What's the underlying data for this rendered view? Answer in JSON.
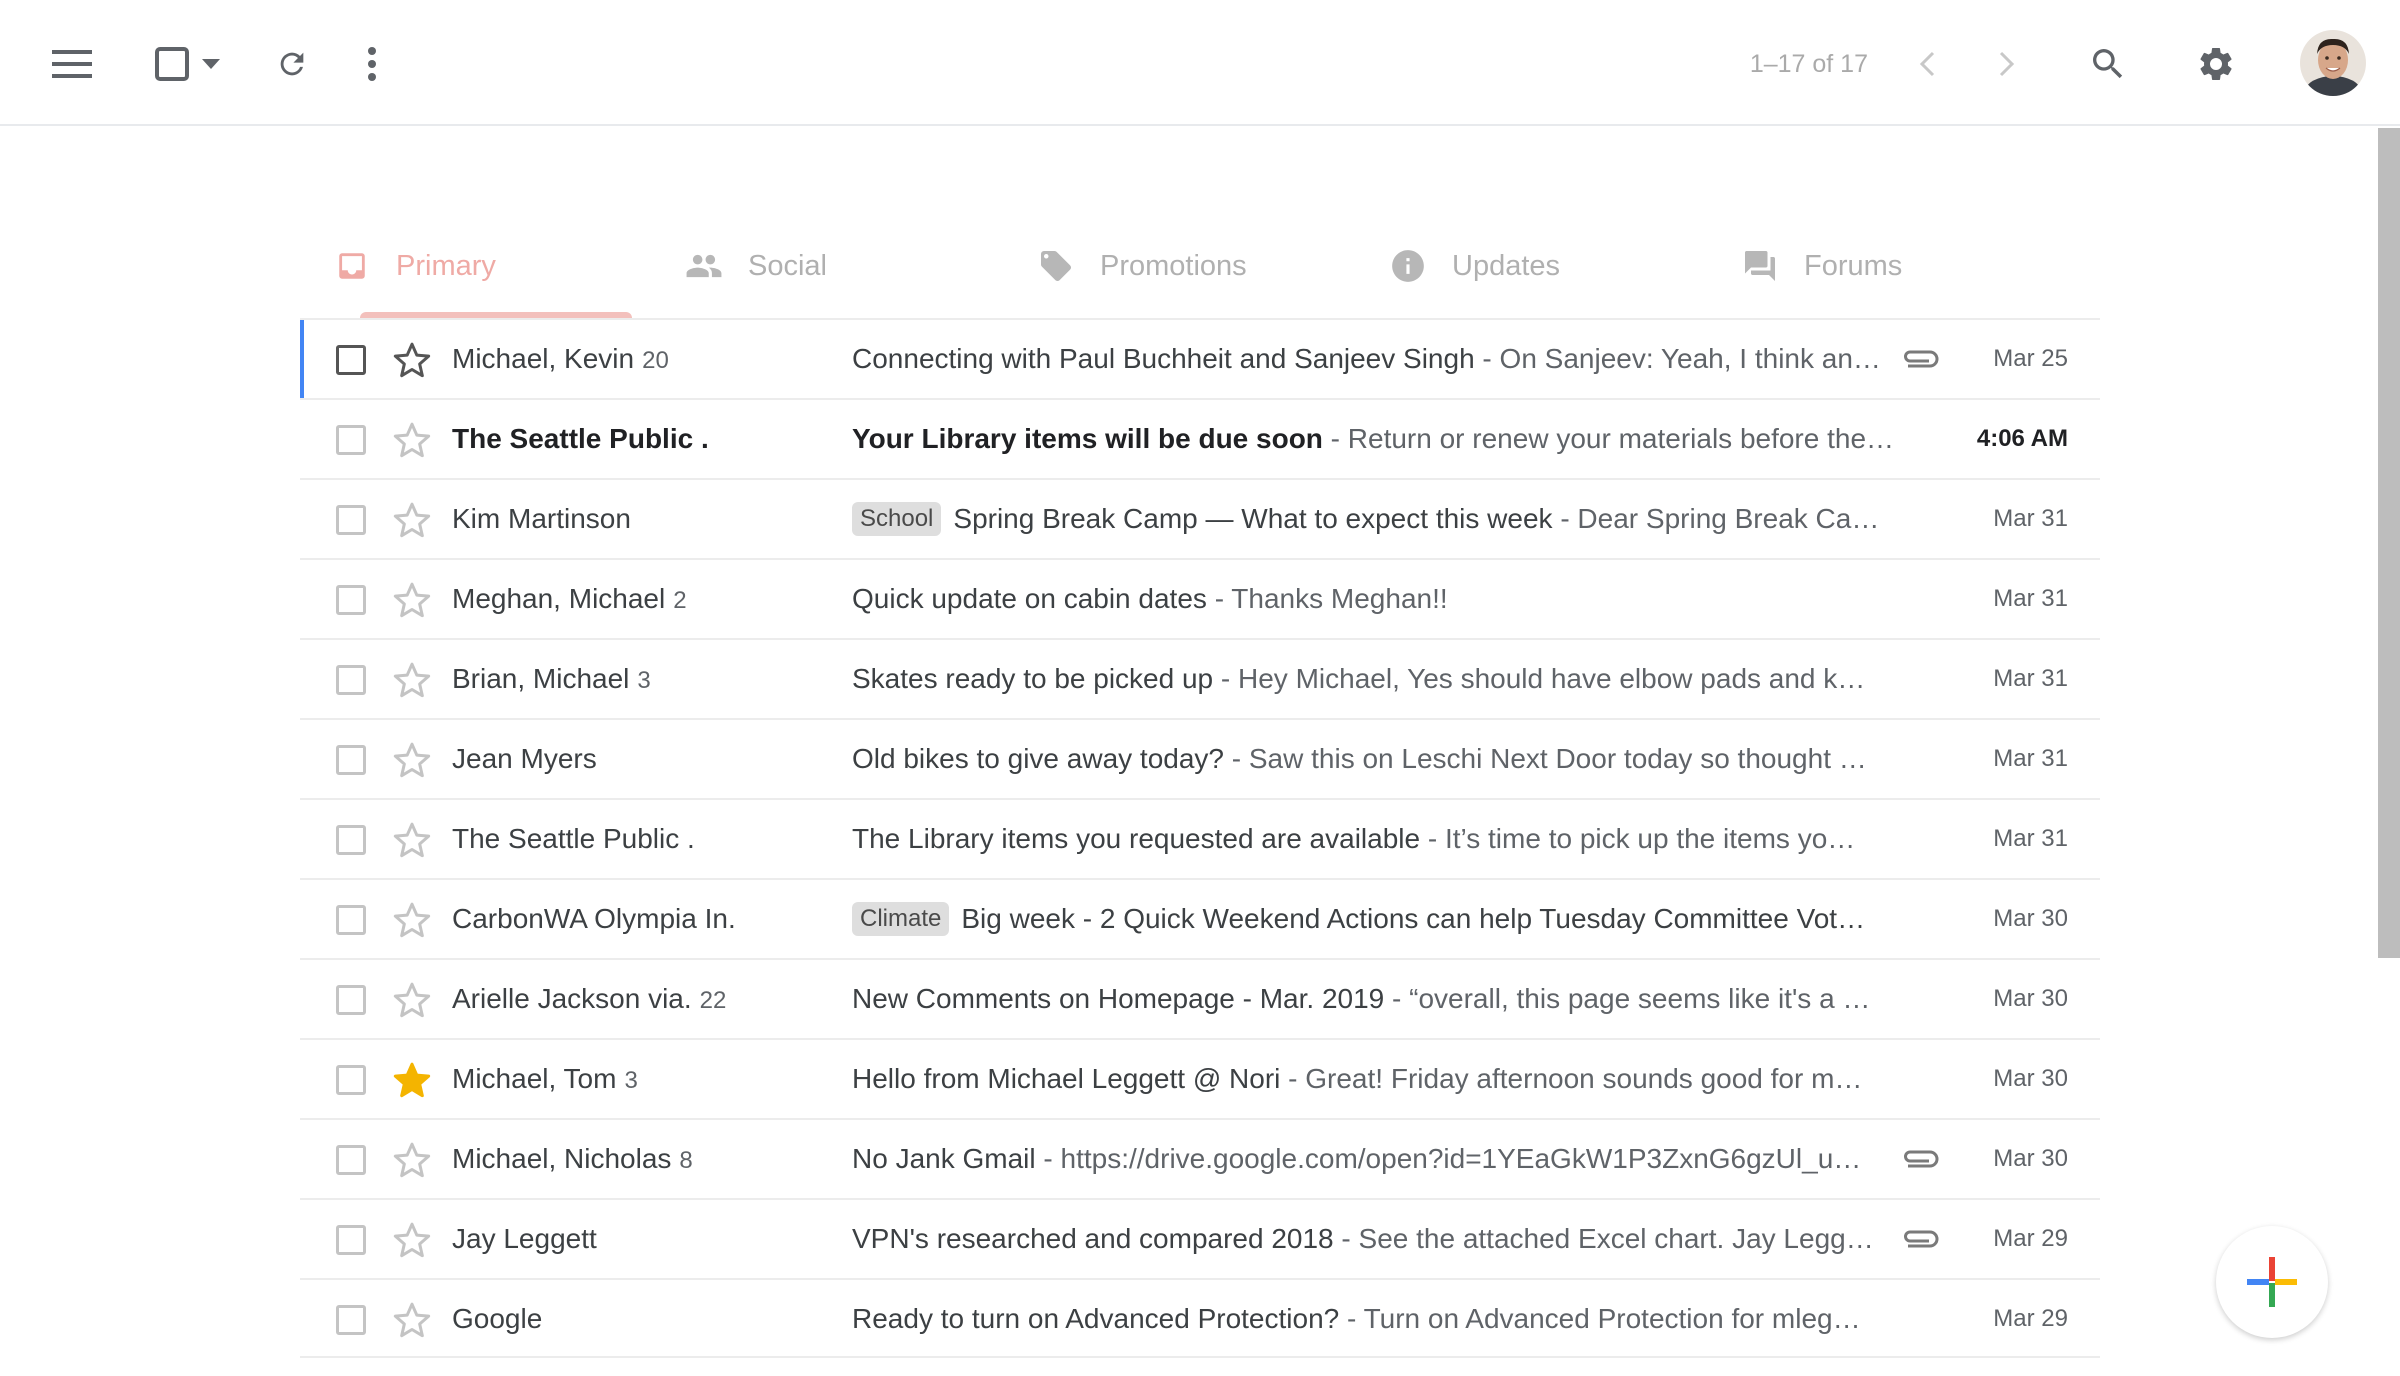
{
  "toolbar": {
    "menu_icon": "hamburger-menu-icon",
    "select_icon": "checkbox-icon",
    "select_dropdown_icon": "caret-down-icon",
    "refresh_icon": "refresh-icon",
    "more_icon": "more-vertical-icon",
    "pager_text": "1–17 of 17",
    "prev_icon": "chevron-left-icon",
    "next_icon": "chevron-right-icon",
    "search_icon": "search-icon",
    "settings_icon": "gear-icon"
  },
  "tabs": [
    {
      "label": "Primary",
      "icon": "inbox-icon",
      "active": true
    },
    {
      "label": "Social",
      "icon": "people-icon",
      "active": false
    },
    {
      "label": "Promotions",
      "icon": "tag-icon",
      "active": false
    },
    {
      "label": "Updates",
      "icon": "info-icon",
      "active": false
    },
    {
      "label": "Forums",
      "icon": "forum-icon",
      "active": false
    }
  ],
  "emails": [
    {
      "sender": "Michael, Kevin",
      "count": "20",
      "label": "",
      "subject": "Connecting with Paul Buchheit and Sanjeev Singh",
      "snippet": " - On Sanjeev: Yeah, I think an…",
      "attachment": true,
      "date": "Mar 25",
      "unread": false,
      "starred": false,
      "focused": true
    },
    {
      "sender": "The Seattle Public .",
      "count": "",
      "label": "",
      "subject": "Your Library items will be due soon",
      "snippet": " - Return or renew your materials before the…",
      "attachment": false,
      "date": "4:06 AM",
      "unread": true,
      "starred": false,
      "focused": false
    },
    {
      "sender": "Kim Martinson",
      "count": "",
      "label": "School",
      "subject": "Spring Break Camp — What to expect this week",
      "snippet": " - Dear Spring Break Ca…",
      "attachment": false,
      "date": "Mar 31",
      "unread": false,
      "starred": false,
      "focused": false
    },
    {
      "sender": "Meghan, Michael",
      "count": "2",
      "label": "",
      "subject": "Quick update on cabin dates",
      "snippet": " - Thanks Meghan!!",
      "attachment": false,
      "date": "Mar 31",
      "unread": false,
      "starred": false,
      "focused": false
    },
    {
      "sender": "Brian, Michael",
      "count": "3",
      "label": "",
      "subject": "Skates ready to be picked up",
      "snippet": " - Hey Michael, Yes should have elbow pads and k…",
      "attachment": false,
      "date": "Mar 31",
      "unread": false,
      "starred": false,
      "focused": false
    },
    {
      "sender": "Jean Myers",
      "count": "",
      "label": "",
      "subject": "Old bikes to give away today?",
      "snippet": " - Saw this on Leschi Next Door today so thought …",
      "attachment": false,
      "date": "Mar 31",
      "unread": false,
      "starred": false,
      "focused": false
    },
    {
      "sender": "The Seattle Public .",
      "count": "",
      "label": "",
      "subject": "The Library items you requested are available",
      "snippet": " - It’s time to pick up the items yo…",
      "attachment": false,
      "date": "Mar 31",
      "unread": false,
      "starred": false,
      "focused": false
    },
    {
      "sender": "CarbonWA Olympia In.",
      "count": "",
      "label": "Climate",
      "subject": "Big week - 2 Quick Weekend Actions can help Tuesday Committee Vot…",
      "snippet": "",
      "attachment": false,
      "date": "Mar 30",
      "unread": false,
      "starred": false,
      "focused": false
    },
    {
      "sender": "Arielle Jackson via.",
      "count": "22",
      "label": "",
      "subject": "New Comments on Homepage - Mar. 2019",
      "snippet": " - “overall, this page seems like it's a …",
      "attachment": false,
      "date": "Mar 30",
      "unread": false,
      "starred": false,
      "focused": false
    },
    {
      "sender": "Michael, Tom",
      "count": "3",
      "label": "",
      "subject": "Hello from Michael Leggett @ Nori",
      "snippet": " - Great! Friday afternoon sounds good for m…",
      "attachment": false,
      "date": "Mar 30",
      "unread": false,
      "starred": true,
      "focused": false
    },
    {
      "sender": "Michael, Nicholas",
      "count": "8",
      "label": "",
      "subject": "No Jank Gmail",
      "snippet": " - https://drive.google.com/open?id=1YEaGkW1P3ZxnG6gzUl_u…",
      "attachment": true,
      "date": "Mar 30",
      "unread": false,
      "starred": false,
      "focused": false
    },
    {
      "sender": "Jay Leggett",
      "count": "",
      "label": "",
      "subject": "VPN's researched and compared 2018",
      "snippet": " - See the attached Excel chart. Jay Legg…",
      "attachment": true,
      "date": "Mar 29",
      "unread": false,
      "starred": false,
      "focused": false
    },
    {
      "sender": "Google",
      "count": "",
      "label": "",
      "subject": "Ready to turn on Advanced Protection?",
      "snippet": " - Turn on Advanced Protection for mleg…",
      "attachment": false,
      "date": "Mar 29",
      "unread": false,
      "starred": false,
      "focused": false
    }
  ],
  "compose": {
    "icon": "plus-icon"
  },
  "colors": {
    "accent_blue": "#4285f4",
    "tab_active": "#efaaa5",
    "star_yellow": "#f4b400"
  }
}
